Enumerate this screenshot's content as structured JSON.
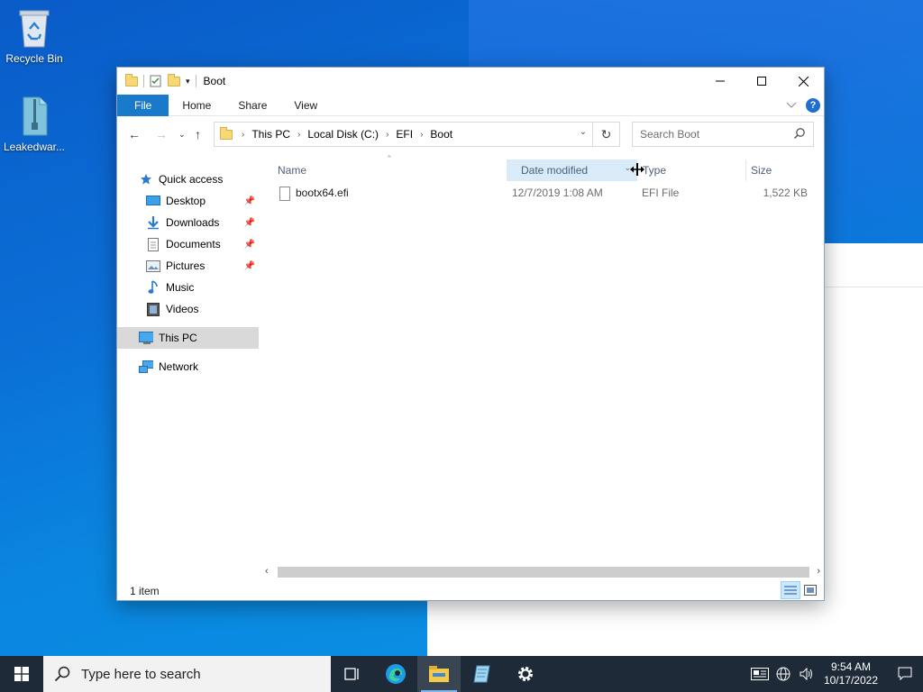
{
  "desktop": {
    "icons": [
      {
        "label": "Recycle Bin"
      },
      {
        "label": "Leakedwar..."
      }
    ]
  },
  "window": {
    "title": "Boot",
    "ribbon_tabs": [
      "File",
      "Home",
      "Share",
      "View"
    ],
    "breadcrumb": [
      "This PC",
      "Local Disk (C:)",
      "EFI",
      "Boot"
    ],
    "search_placeholder": "Search Boot",
    "nav": {
      "quick_access": "Quick access",
      "pinned": [
        "Desktop",
        "Downloads",
        "Documents",
        "Pictures"
      ],
      "unpinned": [
        "Music",
        "Videos"
      ],
      "this_pc": "This PC",
      "network": "Network"
    },
    "columns": [
      "Name",
      "Date modified",
      "Type",
      "Size"
    ],
    "files": [
      {
        "name": "bootx64.efi",
        "date": "12/7/2019 1:08 AM",
        "type": "EFI File",
        "size": "1,522 KB"
      }
    ],
    "status": "1 item"
  },
  "taskbar": {
    "search_placeholder": "Type here to search",
    "time": "9:54 AM",
    "date": "10/17/2022"
  },
  "colors": {
    "accent": "#1979ca",
    "selected_nav": "#d9d9d9",
    "header_hover": "#d9ebf9",
    "taskbar": "#1f2a38"
  }
}
